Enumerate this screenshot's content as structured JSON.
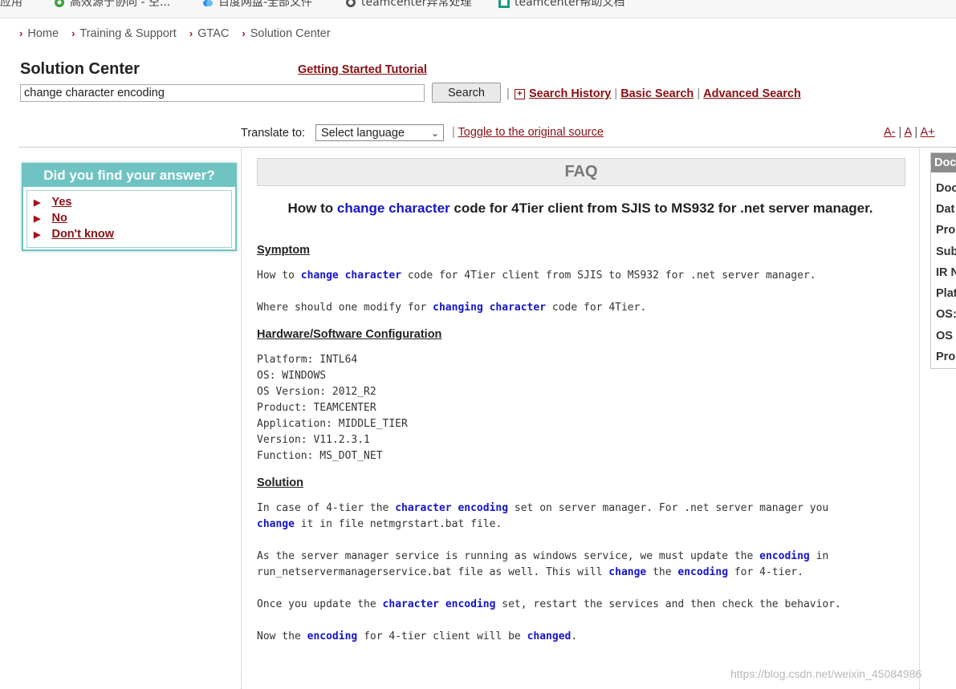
{
  "bookmarks": [
    {
      "label": "应用",
      "icon": "apps-icon"
    },
    {
      "label": "高效源于协同 - 空...",
      "icon": "leaf-icon"
    },
    {
      "label": "百度网盘-全部文件",
      "icon": "cloud-icon"
    },
    {
      "label": "teamcenter异常处理",
      "icon": "globe-icon"
    },
    {
      "label": "teamcenter帮助文档",
      "icon": "s-logo-icon"
    }
  ],
  "breadcrumb": [
    "Home",
    "Training & Support",
    "GTAC",
    "Solution Center"
  ],
  "header": {
    "title": "Solution Center",
    "tutorial_link": "Getting Started Tutorial",
    "search_value": "change character encoding",
    "search_button": "Search",
    "links": {
      "history": "Search History",
      "basic": "Basic Search",
      "advanced": "Advanced Search"
    }
  },
  "translate": {
    "label": "Translate to:",
    "selected": "Select language",
    "toggle": "Toggle to the original source",
    "sizes": [
      "A-",
      "A",
      "A+"
    ]
  },
  "answer_box": {
    "title": "Did you find your answer?",
    "options": [
      "Yes",
      "No",
      "Don't know"
    ]
  },
  "faq": {
    "bar": "FAQ",
    "title": {
      "t1": "How to ",
      "h1": "change character",
      "t2": " code for 4Tier client from SJIS to MS932 for .net server manager."
    },
    "symptom_head": "Symptom",
    "symptom1": {
      "t1": "How to ",
      "h1": "change character",
      "t2": " code for 4Tier client from SJIS to MS932 for .net server manager."
    },
    "symptom2": {
      "t1": "Where should one modify for ",
      "h1": "changing character",
      "t2": " code for 4Tier."
    },
    "config_head": "Hardware/Software Configuration",
    "config": [
      "Platform: INTL64",
      "OS: WINDOWS",
      "OS Version: 2012_R2",
      "Product: TEAMCENTER",
      "Application: MIDDLE_TIER",
      "Version: V11.2.3.1",
      "Function: MS_DOT_NET"
    ],
    "solution_head": "Solution",
    "sol1a": {
      "t1": "In case of 4-tier the ",
      "h1": "character encoding",
      "t2": " set on server manager. For .net server manager you"
    },
    "sol1b": {
      "h1": "change",
      "t2": " it in file netmgrstart.bat file."
    },
    "sol2a": {
      "t1": "As the server manager service is running as windows service, we must update the ",
      "h1": "encoding",
      "t2": " in"
    },
    "sol2b": {
      "t1": "run_netservermanagerservice.bat file as well. This will ",
      "h1": "change",
      "t2": " the ",
      "h2": "encoding",
      "t3": " for 4-tier."
    },
    "sol3": {
      "t1": "Once you update the ",
      "h1": "character encoding",
      "t2": " set, restart the services and then check the behavior."
    },
    "sol4": {
      "t1": "Now the ",
      "h1": "encoding",
      "t2": " for 4-tier client will be ",
      "h2": "changed",
      "t3": "."
    }
  },
  "side_panel": {
    "head": "Doc",
    "items": [
      "Doc",
      "Dat",
      "Pro",
      "Sub",
      "IR N",
      "Plat",
      "OS:",
      "OS",
      "Pro"
    ]
  },
  "watermark": "https://blog.csdn.net/weixin_45084986"
}
